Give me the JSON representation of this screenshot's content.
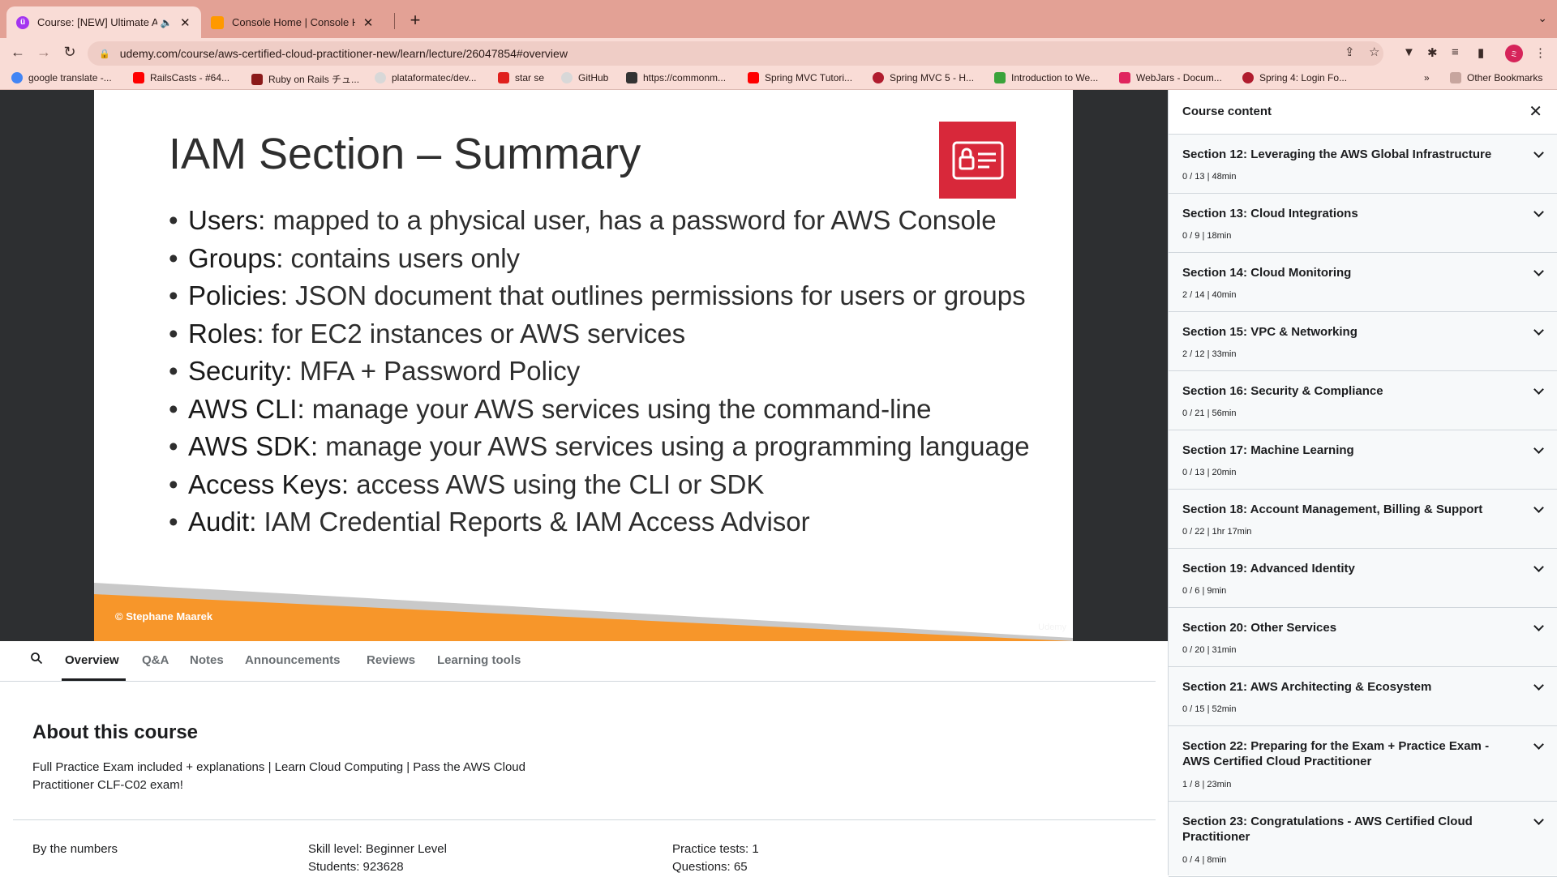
{
  "browser": {
    "tabs": [
      {
        "title": "Course: [NEW] Ultimate AWS",
        "active": true
      },
      {
        "title": "Console Home | Console Home",
        "active": false
      }
    ],
    "url": "udemy.com/course/aws-certified-cloud-practitioner-new/learn/lecture/26047854#overview",
    "bookmarks": [
      "google translate -...",
      "RailsCasts - #64...",
      "Ruby on Rails チュ...",
      "plataformatec/dev...",
      "star se",
      "GitHub",
      "https://commonm...",
      "Spring MVC Tutori...",
      "Spring MVC 5 - H...",
      "Introduction to We...",
      "WebJars - Docum...",
      "Spring 4: Login Fo..."
    ],
    "other_bookmarks": "Other Bookmarks",
    "avatar_initials": "ミ"
  },
  "slide": {
    "title": "IAM Section – Summary",
    "bullets": [
      {
        "key": "Users:",
        "text": " mapped to a physical user, has a password for AWS Console"
      },
      {
        "key": "Groups:",
        "text": " contains users only"
      },
      {
        "key": "Policies:",
        "text": " JSON document that outlines permissions for users or groups"
      },
      {
        "key": "Roles:",
        "text": " for EC2 instances or AWS services"
      },
      {
        "key": "Security:",
        "text": " MFA + Password Policy"
      },
      {
        "key": "AWS CLI:",
        "text": " manage your AWS services using the command-line"
      },
      {
        "key": "AWS SDK:",
        "text": " manage your AWS services using a programming language"
      },
      {
        "key": "Access Keys:",
        "text": " access AWS using the CLI or SDK"
      },
      {
        "key": "Audit:",
        "text": " IAM Credential Reports & IAM Access Advisor"
      }
    ],
    "copyright": "© Stephane Maarek",
    "watermark": "Udemy",
    "badge_color": "#d8283a",
    "footer_color": "#f7962a"
  },
  "lecture_tabs": [
    "Overview",
    "Q&A",
    "Notes",
    "Announcements",
    "Reviews",
    "Learning tools"
  ],
  "about": {
    "heading": "About this course",
    "description": "Full Practice Exam included + explanations | Learn Cloud Computing | Pass the AWS Cloud Practitioner CLF-C02 exam!",
    "by_the_numbers": "By the numbers",
    "skill_level": "Skill level: Beginner Level",
    "students": "Students: 923628",
    "practice_tests": "Practice tests: 1",
    "questions": "Questions: 65"
  },
  "sidebar": {
    "title": "Course content",
    "sections": [
      {
        "title": "Section 12: Leveraging the AWS Global Infrastructure",
        "meta": "0 / 13 | 48min"
      },
      {
        "title": "Section 13: Cloud Integrations",
        "meta": "0 / 9 | 18min"
      },
      {
        "title": "Section 14: Cloud Monitoring",
        "meta": "2 / 14 | 40min"
      },
      {
        "title": "Section 15: VPC & Networking",
        "meta": "2 / 12 | 33min"
      },
      {
        "title": "Section 16: Security & Compliance",
        "meta": "0 / 21 | 56min"
      },
      {
        "title": "Section 17: Machine Learning",
        "meta": "0 / 13 | 20min"
      },
      {
        "title": "Section 18: Account Management, Billing & Support",
        "meta": "0 / 22 | 1hr 17min"
      },
      {
        "title": "Section 19: Advanced Identity",
        "meta": "0 / 6 | 9min"
      },
      {
        "title": "Section 20: Other Services",
        "meta": "0 / 20 | 31min"
      },
      {
        "title": "Section 21: AWS Architecting & Ecosystem",
        "meta": "0 / 15 | 52min"
      },
      {
        "title": "Section 22: Preparing for the Exam + Practice Exam - AWS Certified Cloud Practitioner",
        "meta": "1 / 8 | 23min"
      },
      {
        "title": "Section 23: Congratulations - AWS Certified Cloud Practitioner",
        "meta": "0 / 4 | 8min"
      }
    ]
  }
}
